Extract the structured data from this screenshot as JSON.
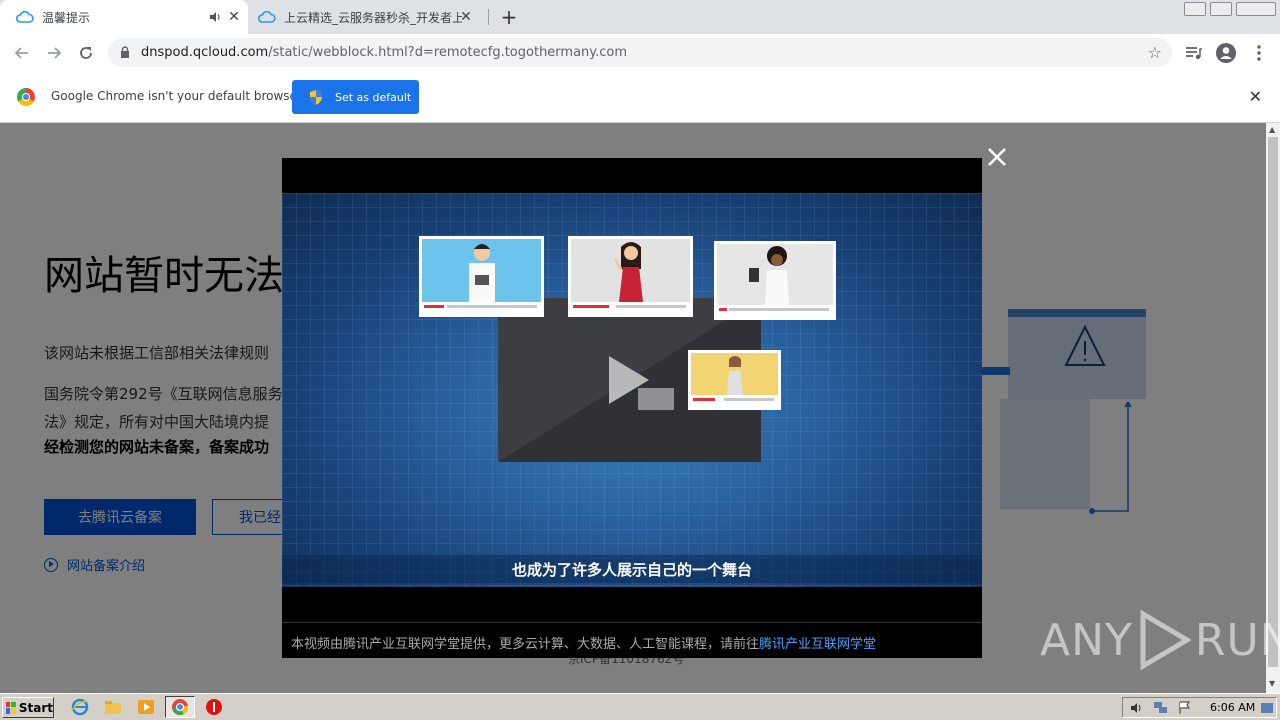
{
  "browser": {
    "tabs": [
      {
        "title": "温馨提示",
        "active": true
      },
      {
        "title": "上云精选_云服务器秒杀_开发者上云",
        "active": false
      }
    ],
    "url_host": "dnspod.qcloud.com",
    "url_path": "/static/webblock.html?d=remotecfg.togothermany.com"
  },
  "infobar": {
    "message": "Google Chrome isn't your default browser",
    "button": "Set as default"
  },
  "page": {
    "headline": "网站暂时无法",
    "p1": "该网站未根据工信部相关法律规则",
    "p2_line1": "国务院令第292号《互联网信息服务",
    "p2_line2": "法》规定，所有对中国大陆境内提",
    "p3": "经检测您的网站未备案，备案成功",
    "btn_go": "去腾讯云备案",
    "btn_done": "我已经",
    "intro_link": "网站备案介绍",
    "icp": "京ICP备11018762号"
  },
  "video": {
    "subtitle": "也成为了许多人展示自己的一个舞台",
    "footer_text": "本视频由腾讯产业互联网学堂提供，更多云计算、大数据、人工智能课程，请前往",
    "footer_link": "腾讯产业互联网学堂"
  },
  "watermark": {
    "left": "ANY",
    "right": "RUN"
  },
  "taskbar": {
    "start": "Start",
    "clock": "6:06 AM"
  },
  "colors": {
    "accent": "#0052d9",
    "chrome_blue": "#1a73e8",
    "modal_bg": "#000000"
  }
}
